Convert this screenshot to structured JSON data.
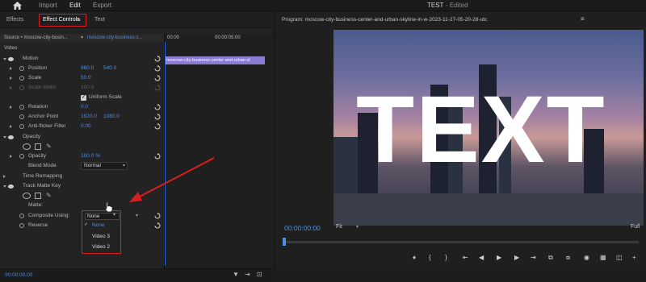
{
  "app": {
    "menus": [
      "Import",
      "Edit",
      "Export"
    ],
    "active_menu": "Edit",
    "doc_title": "TEST",
    "doc_status": "- Edited"
  },
  "left_panel": {
    "tabs": [
      "Effects",
      "Effect Controls",
      "Text"
    ],
    "active_tab": "Effect Controls",
    "source_label": "Source • moscow-city-busin...",
    "clip_dropdown": "moscow-city-business-c...",
    "timeline": {
      "time_start": "00:00",
      "time_mid": "00:00:05:00",
      "clip_name": "moscow-city-business-center-and-urban-sl"
    },
    "video_header": "Video",
    "motion": {
      "name": "Motion",
      "position_label": "Position",
      "position_x": "960.0",
      "position_y": "540.0",
      "scale_label": "Scale",
      "scale_value": "50.0",
      "scale_width_label": "Scale Width",
      "scale_width_value": "100.0",
      "uniform_scale_label": "Uniform Scale",
      "rotation_label": "Rotation",
      "rotation_value": "0.0",
      "anchor_label": "Anchor Point",
      "anchor_x": "1920.0",
      "anchor_y": "1080.0",
      "antiflicker_label": "Anti-flicker Filter",
      "antiflicker_value": "0.00"
    },
    "opacity": {
      "name": "Opacity",
      "opacity_label": "Opacity",
      "opacity_value": "100.0 %",
      "blend_label": "Blend Mode",
      "blend_value": "Normal"
    },
    "time_remapping": "Time Remapping",
    "track_matte": {
      "name": "Track Matte Key",
      "matte_label": "Matte:",
      "matte_value": "None",
      "composite_label": "Composite Using:",
      "reverse_label": "Reverse",
      "options": [
        "None",
        "Video 3",
        "Video 2"
      ],
      "selected_option": "None"
    },
    "bottom_time": "00:00:00:00"
  },
  "program": {
    "title": "Program: moscow-city-business-center-and-urban-skyline-in-w-2023-11-27-05-20-28-utc",
    "overlay_text": "TEXT",
    "timecode": "00:00:00:00",
    "fit_label": "Fit",
    "full_label": "Full"
  },
  "colors": {
    "accent_blue": "#4d8ee6",
    "highlight_red": "#d81f1f",
    "clip_purple": "#8b7cd1"
  }
}
